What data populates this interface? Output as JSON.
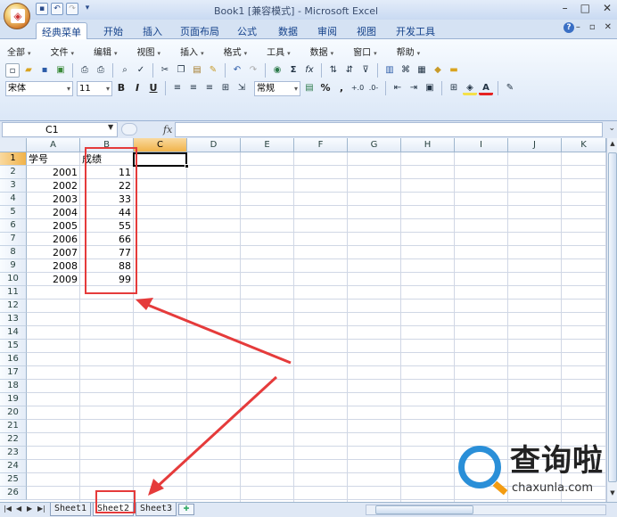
{
  "window": {
    "title": "Book1  [兼容模式] - Microsoft Excel"
  },
  "tabs": [
    {
      "label": "经典菜单",
      "active": true
    },
    {
      "label": "开始"
    },
    {
      "label": "插入"
    },
    {
      "label": "页面布局"
    },
    {
      "label": "公式"
    },
    {
      "label": "数据"
    },
    {
      "label": "审阅"
    },
    {
      "label": "视图"
    },
    {
      "label": "开发工具"
    }
  ],
  "menu": [
    "全部",
    "文件",
    "编辑",
    "视图",
    "插入",
    "格式",
    "工具",
    "数据",
    "窗口",
    "帮助"
  ],
  "format_bar": {
    "font": "宋体",
    "size": "11",
    "bold": "B",
    "italic": "I",
    "underline": "U",
    "number_format": "常规",
    "percent": "%",
    "comma": ","
  },
  "formula_bar": {
    "name_box": "C1",
    "fx": "fx",
    "value": ""
  },
  "columns": [
    "A",
    "B",
    "C",
    "D",
    "E",
    "F",
    "G",
    "H",
    "I",
    "J",
    "K"
  ],
  "selected_column": "C",
  "selected_row": "1",
  "rows": [
    "1",
    "2",
    "3",
    "4",
    "5",
    "6",
    "7",
    "8",
    "9",
    "10",
    "11",
    "12",
    "13",
    "14",
    "15",
    "16",
    "17",
    "18",
    "19",
    "20",
    "21",
    "22",
    "23",
    "24",
    "25",
    "26"
  ],
  "cells": {
    "A1": "学号",
    "B1": "成绩",
    "A": [
      "2001",
      "2002",
      "2003",
      "2004",
      "2005",
      "2006",
      "2007",
      "2008",
      "2009"
    ],
    "B": [
      "11",
      "22",
      "33",
      "44",
      "55",
      "66",
      "77",
      "88",
      "99"
    ]
  },
  "sheets": [
    {
      "label": "Sheet1"
    },
    {
      "label": "Sheet2",
      "active": true
    },
    {
      "label": "Sheet3"
    }
  ],
  "watermark": {
    "text": "查询啦",
    "url": "chaxunla.com"
  },
  "colors": {
    "annotation_red": "#e53b3b",
    "header_selected": "#f1b34a",
    "ribbon_blue": "#dbe7f7",
    "watermark_blue": "#2a8fd8"
  }
}
